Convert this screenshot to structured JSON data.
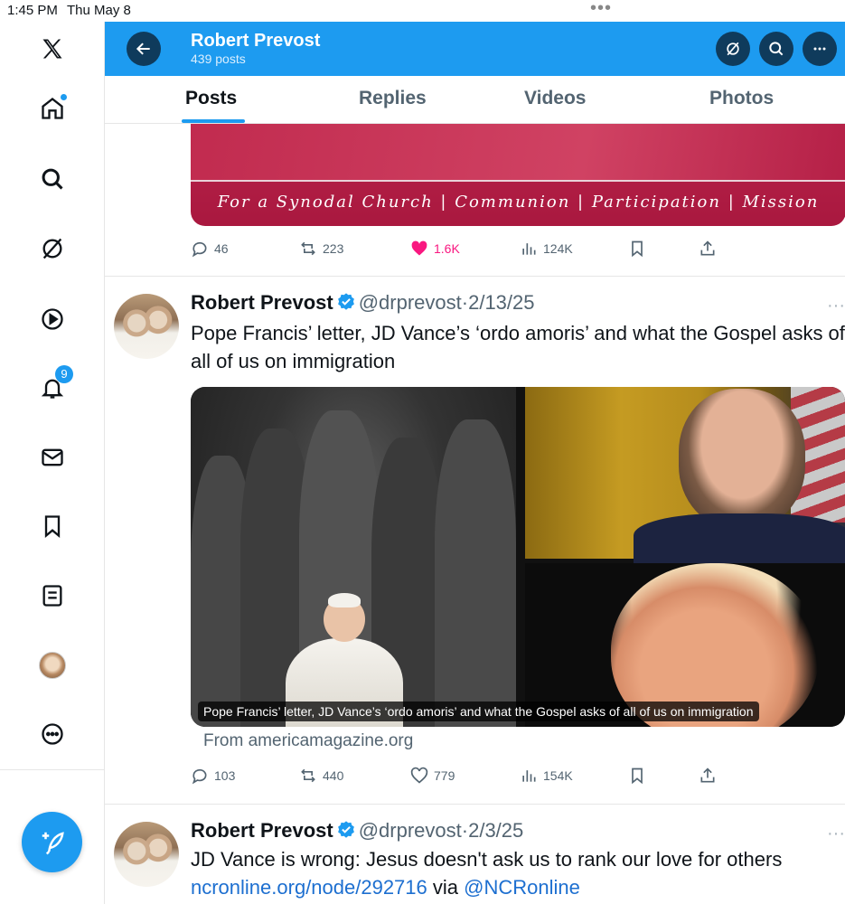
{
  "status_bar": {
    "time": "1:45 PM",
    "date": "Thu May 8",
    "dots": "•••"
  },
  "sidebar": {
    "items": [
      {
        "name": "home",
        "icon": "x-logo-icon"
      },
      {
        "name": "home",
        "icon": "home-icon"
      },
      {
        "name": "explore",
        "icon": "search-icon"
      },
      {
        "name": "grok",
        "icon": "grok-icon"
      },
      {
        "name": "video",
        "icon": "play-icon"
      },
      {
        "name": "notifications",
        "icon": "bell-icon",
        "badge": "9"
      },
      {
        "name": "messages",
        "icon": "mail-icon"
      },
      {
        "name": "bookmarks",
        "icon": "bookmark-icon"
      },
      {
        "name": "lists",
        "icon": "list-icon"
      },
      {
        "name": "profile",
        "icon": "avatar"
      },
      {
        "name": "more",
        "icon": "more-circle-icon"
      }
    ],
    "notification_badge": "9"
  },
  "header": {
    "title": "Robert Prevost",
    "subtitle": "439 posts",
    "accent": "#1d9bf0"
  },
  "tabs": [
    {
      "label": "Posts",
      "active": true
    },
    {
      "label": "Replies",
      "active": false
    },
    {
      "label": "Videos",
      "active": false
    },
    {
      "label": "Photos",
      "active": false
    }
  ],
  "feed": {
    "banner_text": "For a Synodal Church | Communion | Participation | Mission",
    "first_actions": {
      "replies": "46",
      "reposts": "223",
      "likes": "1.6K",
      "views": "124K",
      "liked": true
    },
    "tweets": [
      {
        "name": "Robert Prevost",
        "handle": "@drprevost",
        "sep": "·",
        "date": "2/13/25",
        "text": "Pope Francis’ letter, JD Vance’s ‘ordo amoris’ and what the Gospel asks of all of us on immigration",
        "media_caption": "Pope Francis’ letter, JD Vance’s ‘ordo amoris’ and what the Gospel asks of all of us on immigration",
        "source": "From americamagazine.org",
        "actions": {
          "replies": "103",
          "reposts": "440",
          "likes": "779",
          "views": "154K"
        }
      },
      {
        "name": "Robert Prevost",
        "handle": "@drprevost",
        "sep": "·",
        "date": "2/3/25",
        "text": "JD Vance is wrong: Jesus doesn't ask us to rank our love for others",
        "link": "ncronline.org/node/292716",
        "via": " via ",
        "mention": "@NCRonline"
      }
    ]
  }
}
